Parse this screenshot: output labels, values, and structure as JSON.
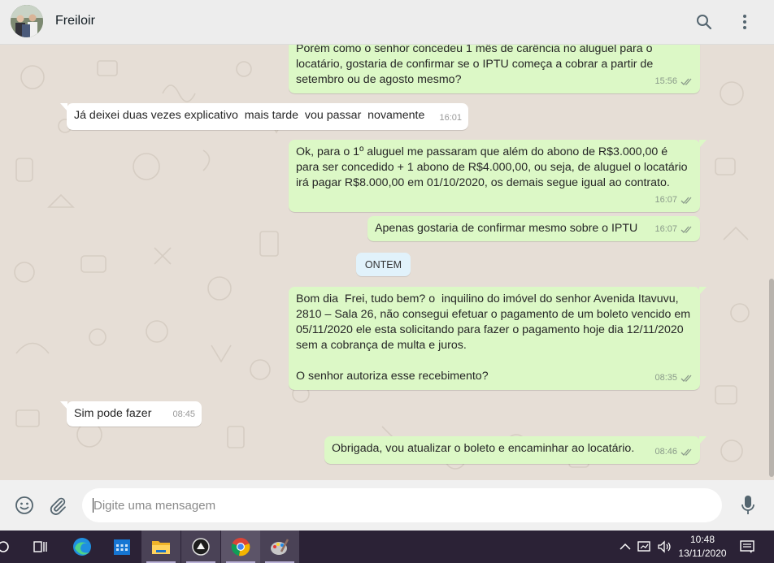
{
  "header": {
    "contact_name": "Freiloir",
    "search_icon": "search-icon",
    "menu_icon": "more-vertical-icon"
  },
  "messages": [
    {
      "direction": "out",
      "text": "Porém como o senhor concedeu 1 mês de carência no aluguel para o locatário, gostaria de confirmar se o IPTU começa a cobrar a partir de setembro ou de agosto mesmo?",
      "time": "15:56"
    },
    {
      "direction": "in",
      "text": "Já deixei duas vezes explicativo  mais tarde  vou passar  novamente",
      "time": "16:01"
    },
    {
      "direction": "out",
      "text": "Ok, para o 1º aluguel me passaram que além do abono de R$3.000,00 é para ser concedido + 1 abono de R$4.000,00, ou seja, de aluguel o locatário irá pagar R$8.000,00 em 01/10/2020, os demais segue igual ao contrato.",
      "time": "16:07"
    },
    {
      "direction": "out",
      "text": "Apenas gostaria de confirmar mesmo sobre o IPTU",
      "time": "16:07"
    },
    {
      "direction": "out",
      "text": "Bom dia  Frei, tudo bem? o  inquilino do imóvel do senhor Avenida Itavuvu, 2810 – Sala 26, não consegui efetuar o pagamento de um boleto vencido em 05/11/2020 ele esta solicitando para fazer o pagamento hoje dia 12/11/2020 sem a cobrança de multa e juros.\n\nO senhor autoriza esse recebimento?",
      "time": "08:35"
    },
    {
      "direction": "in",
      "text": "Sim pode fazer",
      "time": "08:45"
    },
    {
      "direction": "out",
      "text": "Obrigada, vou atualizar o boleto e encaminhar ao locatário.",
      "time": "08:46"
    }
  ],
  "date_separator": "ONTEM",
  "composer": {
    "placeholder": "Digite uma mensagem",
    "emoji_icon": "emoji-icon",
    "attach_icon": "paperclip-icon",
    "mic_icon": "microphone-icon"
  },
  "taskbar": {
    "apps": [
      "start-icon",
      "task-view-icon",
      "edge-icon",
      "calendar-icon",
      "file-explorer-icon",
      "app-icon",
      "chrome-icon",
      "paint-icon"
    ],
    "active_app": "chrome-icon",
    "tray_icons": [
      "chevron-up-icon",
      "network-icon",
      "volume-icon"
    ],
    "time": "10:48",
    "date": "13/11/2020",
    "notification_icon": "notification-icon"
  },
  "colors": {
    "outgoing_bubble": "#dcf8c6",
    "incoming_bubble": "#ffffff",
    "chat_background": "#e6ded6",
    "read_ticks": "#8a9a8a",
    "taskbar": "#2b2236"
  }
}
